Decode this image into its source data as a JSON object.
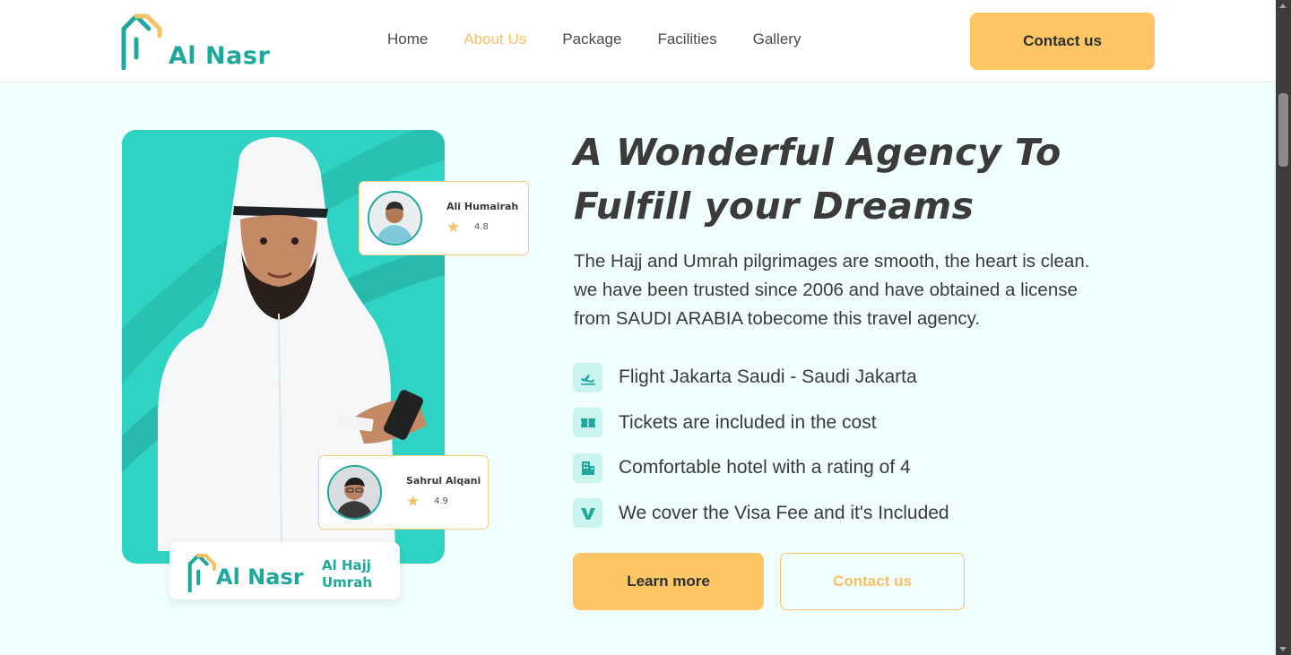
{
  "header": {
    "logo_text": "Al Nasr",
    "nav": [
      {
        "label": "Home",
        "active": false
      },
      {
        "label": "About Us",
        "active": true
      },
      {
        "label": "Package",
        "active": false
      },
      {
        "label": "Facilities",
        "active": false
      },
      {
        "label": "Gallery",
        "active": false
      }
    ],
    "contact_label": "Contact us"
  },
  "hero": {
    "reviews": [
      {
        "name": "Ali Humairah",
        "rating": "4.8",
        "icon": "star-icon"
      },
      {
        "name": "Sahrul Alqani",
        "rating": "4.9",
        "icon": "star-icon"
      }
    ],
    "badge": {
      "logo_text": "Al Nasr",
      "sub_line1": "Al Hajj",
      "sub_line2": "Umrah"
    }
  },
  "content": {
    "title_line1": "A Wonderful Agency To",
    "title_line2": "Fulfill your Dreams",
    "description_line1": "The Hajj and Umrah pilgrimages are smooth, the heart is clean.",
    "description_line2": "we have been trusted since 2006 and have obtained a license",
    "description_line3": "from SAUDI ARABIA tobecome this travel agency.",
    "features": [
      {
        "icon": "flight-icon",
        "text": "Flight Jakarta Saudi - Saudi Jakarta"
      },
      {
        "icon": "ticket-icon",
        "text": "Tickets are included in the cost"
      },
      {
        "icon": "hotel-icon",
        "text": "Comfortable hotel with a rating of 4"
      },
      {
        "icon": "visa-icon",
        "text": "We cover the Visa Fee and it's Included"
      }
    ],
    "learn_more_label": "Learn more",
    "contact_label": "Contact us"
  },
  "colors": {
    "brand": "#1fa89b",
    "accent": "#ffc665",
    "hero_bg": "#2fd3c4",
    "page_bg": "#f0fefd"
  }
}
